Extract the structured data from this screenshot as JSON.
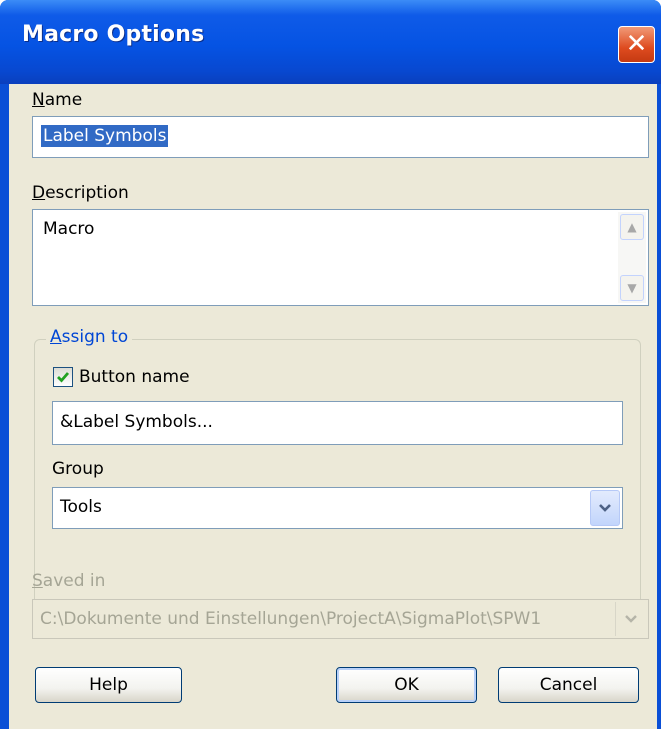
{
  "window": {
    "title": "Macro Options",
    "close_icon": "close-icon"
  },
  "name": {
    "label_underline": "N",
    "label_rest": "ame",
    "value": "Label Symbols"
  },
  "description": {
    "label_underline": "D",
    "label_rest": "escription",
    "value": "Macro"
  },
  "assign_to": {
    "label_underline": "A",
    "label_rest": "ssign to",
    "button_name": {
      "label": "Button name",
      "checked": true,
      "value": "&Label Symbols..."
    },
    "group": {
      "label": "Group",
      "selected": "Tools"
    }
  },
  "saved_in": {
    "label_underline": "S",
    "label_rest": "aved in",
    "value": "C:\\Dokumente und Einstellungen\\ProjectA\\SigmaPlot\\SPW1"
  },
  "buttons": {
    "help": "Help",
    "ok": "OK",
    "cancel": "Cancel"
  },
  "colors": {
    "title_bar": "#0553e3",
    "client_bg": "#ece9d8",
    "selection": "#316ac5",
    "group_label": "#0046d5"
  }
}
